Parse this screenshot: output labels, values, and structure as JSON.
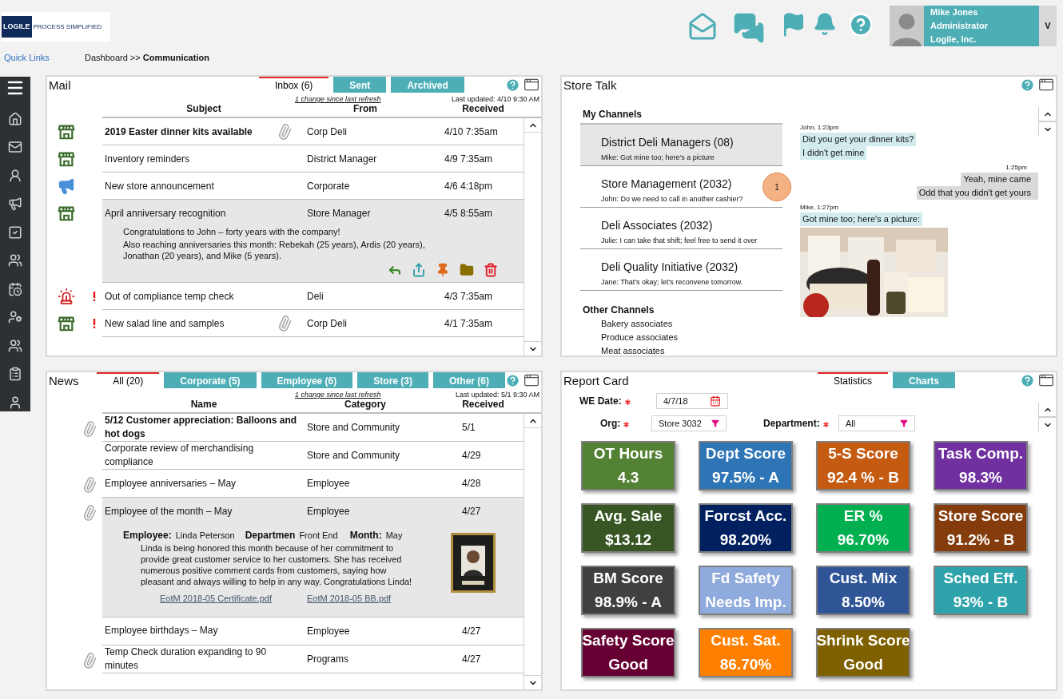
{
  "header": {
    "logo": {
      "brand": "LOGILE",
      "tagline": "PROCESS SIMPLIFIED"
    },
    "quick_links": "Quick Links",
    "breadcrumb": {
      "parent": "Dashboard >>",
      "current": "Communication"
    },
    "user": {
      "name": "Mike Jones",
      "role": "Administrator",
      "company": "Logile, Inc.",
      "menu": "V"
    }
  },
  "mail": {
    "title": "Mail",
    "tabs": [
      {
        "label": "Inbox (6)",
        "selected": true
      },
      {
        "label": "Sent",
        "selected": false
      },
      {
        "label": "Archived",
        "selected": false
      }
    ],
    "change_note": "1 change since last refresh",
    "last_updated": "Last updated: 4/10 9:30 AM",
    "columns": [
      "Subject",
      "From",
      "Received"
    ],
    "rows": [
      {
        "kind": "store",
        "important": false,
        "subject": "2019 Easter dinner kits available",
        "unread": true,
        "attachment": true,
        "from": "Corp Deli",
        "received": "4/10 7:35am",
        "expanded": false
      },
      {
        "kind": "store",
        "important": false,
        "subject": "Inventory reminders",
        "unread": false,
        "attachment": false,
        "from": "District Manager",
        "received": "4/9 7:35am",
        "expanded": false
      },
      {
        "kind": "megaphone",
        "important": false,
        "subject": "New store announcement",
        "unread": false,
        "attachment": false,
        "from": "Corporate",
        "received": "4/6 4:18pm",
        "expanded": false
      },
      {
        "kind": "store",
        "important": false,
        "subject": "April anniversary recognition",
        "unread": false,
        "attachment": false,
        "from": "Store Manager",
        "received": "4/5 8:55am",
        "expanded": true,
        "body": [
          "Congratulations to John – forty years with the company!",
          "Also reaching anniversaries this month: Rebekah (25 years), Ardis (20 years), Jonathan (20 years), and Mike (5 years)."
        ]
      },
      {
        "kind": "siren",
        "important": true,
        "subject": "Out of compliance temp check",
        "unread": false,
        "attachment": false,
        "from": "Deli",
        "received": "4/3 7:35am",
        "expanded": false
      },
      {
        "kind": "store",
        "important": true,
        "subject": "New salad line and samples",
        "unread": false,
        "attachment": true,
        "from": "Corp Deli",
        "received": "4/1 7:35am",
        "expanded": false
      }
    ]
  },
  "store_talk": {
    "title": "Store Talk",
    "my_channels_heading": "My Channels",
    "channels": [
      {
        "name": "District Deli Managers (08)",
        "preview": "Mike: Got mine too; here's a picture",
        "selected": true
      },
      {
        "name": "Store Management (2032)",
        "preview": "John: Do we need to call in another cashier?",
        "selected": false,
        "badge": "1"
      },
      {
        "name": "Deli Associates (2032)",
        "preview": "Julie: I can take that shift; feel free to send it over",
        "selected": false
      },
      {
        "name": "Deli Quality Initiative (2032)",
        "preview": "Jane: That's okay; let's reconvene tomorrow.",
        "selected": false
      }
    ],
    "other_channels_heading": "Other Channels",
    "other_channels": [
      "Bakery associates",
      "Produce associates",
      "Meat associates"
    ],
    "messages": [
      {
        "kind": "incoming",
        "meta": "John, 1:23pm",
        "lines": [
          "Did you get your dinner kits?",
          "I didn't get mine"
        ],
        "has_picture": false
      },
      {
        "kind": "outgoing",
        "meta": "1:25pm",
        "lines": [
          "Yeah, mine came",
          "Odd that you didn't get yours"
        ],
        "has_picture": false
      },
      {
        "kind": "incoming",
        "meta": "Mike, 1:27pm",
        "lines": [
          "Got mine too; here's a picture:"
        ],
        "has_picture": true
      }
    ]
  },
  "news": {
    "title": "News",
    "tabs": [
      {
        "label": "All (20)",
        "selected": true
      },
      {
        "label": "Corporate (5)",
        "selected": false
      },
      {
        "label": "Employee (6)",
        "selected": false
      },
      {
        "label": "Store (3)",
        "selected": false
      },
      {
        "label": "Other (6)",
        "selected": false
      }
    ],
    "change_note": "1 change since last refresh",
    "last_updated": "Last updated: 5/1 9:30 AM",
    "columns": [
      "Name",
      "Category",
      "Received"
    ],
    "rows": [
      {
        "name": "5/12 Customer appreciation: Balloons and hot dogs",
        "unread": true,
        "attachment": true,
        "category": "Store and Community",
        "received": "5/1",
        "expanded": false
      },
      {
        "name": "Corporate review of merchandising compliance",
        "unread": false,
        "attachment": false,
        "category": "Store and Community",
        "received": "4/29",
        "expanded": false
      },
      {
        "name": "Employee anniversaries – May",
        "unread": false,
        "attachment": true,
        "category": "Employee",
        "received": "4/28",
        "expanded": false
      },
      {
        "name": "Employee of the month – May",
        "unread": false,
        "attachment": true,
        "category": "Employee",
        "received": "4/27",
        "expanded": true,
        "detail": {
          "employee_label": "Employee:",
          "employee": "Linda Peterson",
          "department_label": "Departmen",
          "department": "Front End",
          "month_label": "Month:",
          "month": "May",
          "text": "Linda is being honored this month because of her commitment to provide great customer service to her customers.  She has received numerous positive comment cards from customers, saying how pleasant and always willing to help in any way.  Congratulations Linda!",
          "links": [
            "EotM 2018-05 Certificate.pdf",
            "EotM 2018-05 BB.pdf"
          ]
        }
      },
      {
        "name": "Employee birthdays – May",
        "unread": false,
        "attachment": false,
        "category": "Employee",
        "received": "4/27",
        "expanded": false
      },
      {
        "name": "Temp Check duration expanding to 90 minutes",
        "unread": false,
        "attachment": true,
        "category": "Programs",
        "received": "4/27",
        "expanded": false
      }
    ]
  },
  "report_card": {
    "title": "Report Card",
    "tabs": [
      {
        "label": "Statistics",
        "selected": true
      },
      {
        "label": "Charts",
        "selected": false
      }
    ],
    "fields": {
      "we_date": {
        "label": "WE Date:",
        "required": true,
        "value": "4/7/18"
      },
      "org": {
        "label": "Org:",
        "required": true,
        "value": "Store 3032"
      },
      "department": {
        "label": "Department:",
        "required": true,
        "value": "All"
      }
    },
    "tiles": [
      {
        "title": "OT Hours",
        "value": "4.3",
        "color": "#548235"
      },
      {
        "title": "Dept Score",
        "value": "97.5% - A",
        "color": "#2e75b6"
      },
      {
        "title": "5-S Score",
        "value": "92.4 % - B",
        "color": "#c55a11"
      },
      {
        "title": "Task Comp.",
        "value": "98.3%",
        "color": "#7030a0"
      },
      {
        "title": "Avg. Sale",
        "value": "$13.12",
        "color": "#375623"
      },
      {
        "title": "Forcst Acc.",
        "value": "98.20%",
        "color": "#002060"
      },
      {
        "title": "ER %",
        "value": "96.70%",
        "color": "#00b050"
      },
      {
        "title": "Store Score",
        "value": "91.2% - B",
        "color": "#843c0c"
      },
      {
        "title": "BM Score",
        "value": "98.9% - A",
        "color": "#404040"
      },
      {
        "title": "Fd Safety",
        "value": "Needs Imp.",
        "color": "#8faadc"
      },
      {
        "title": "Cust. Mix",
        "value": "8.50%",
        "color": "#2f5597"
      },
      {
        "title": "Sched Eff.",
        "value": "93% - B",
        "color": "#2ea3ab"
      },
      {
        "title": "Safety Score",
        "value": "Good",
        "color": "#660033"
      },
      {
        "title": "Cust. Sat.",
        "value": "86.70%",
        "color": "#ff8000"
      },
      {
        "title": "Shrink Score",
        "value": "Good",
        "color": "#7f6000"
      }
    ]
  }
}
